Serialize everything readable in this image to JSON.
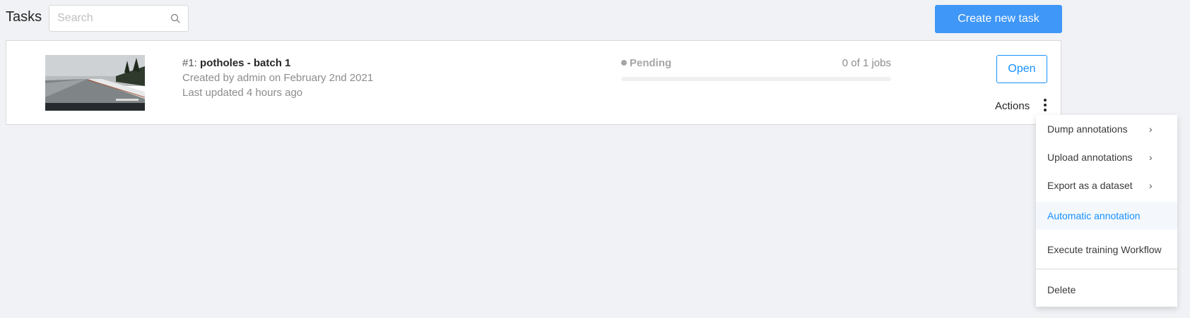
{
  "header": {
    "title": "Tasks",
    "search_placeholder": "Search",
    "create_button": "Create new task"
  },
  "task": {
    "id_prefix": "#1:",
    "name": "potholes - batch 1",
    "created": "Created by admin on February 2nd 2021",
    "updated": "Last updated 4 hours ago",
    "status": "Pending",
    "jobs": "0 of 1 jobs",
    "progress": 0,
    "open_button": "Open",
    "actions_label": "Actions"
  },
  "actions_menu": {
    "items": [
      {
        "label": "Dump annotations",
        "has_submenu": true
      },
      {
        "label": "Upload annotations",
        "has_submenu": true
      },
      {
        "label": "Export as a dataset",
        "has_submenu": true
      },
      {
        "label": "Automatic annotation",
        "has_submenu": false
      },
      {
        "label": "Execute training Workflow",
        "has_submenu": false
      },
      {
        "label": "Delete",
        "has_submenu": false
      }
    ]
  },
  "colors": {
    "primary": "#3f97f7",
    "link": "#1890ff",
    "status_pending": "#a6a6a6",
    "background": "#f0f2f5"
  },
  "icons": {
    "search": "search-icon",
    "more": "more-vertical-icon",
    "chevron": "chevron-right-icon"
  }
}
